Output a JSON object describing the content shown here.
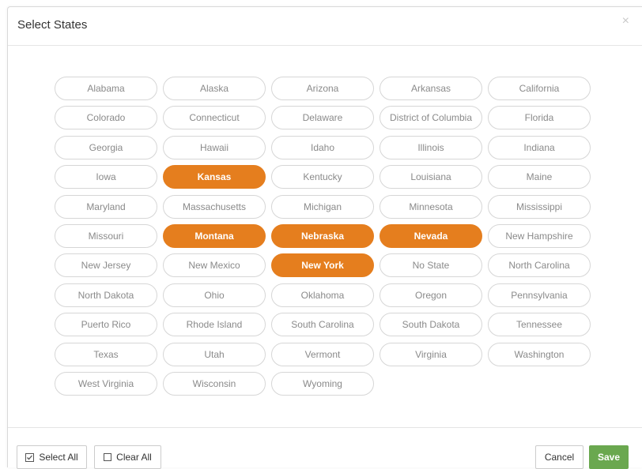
{
  "modal": {
    "title": "Select States",
    "close_glyph": "×"
  },
  "states": [
    {
      "label": "Alabama",
      "selected": false
    },
    {
      "label": "Alaska",
      "selected": false
    },
    {
      "label": "Arizona",
      "selected": false
    },
    {
      "label": "Arkansas",
      "selected": false
    },
    {
      "label": "California",
      "selected": false
    },
    {
      "label": "Colorado",
      "selected": false
    },
    {
      "label": "Connecticut",
      "selected": false
    },
    {
      "label": "Delaware",
      "selected": false
    },
    {
      "label": "District of Columbia",
      "selected": false
    },
    {
      "label": "Florida",
      "selected": false
    },
    {
      "label": "Georgia",
      "selected": false
    },
    {
      "label": "Hawaii",
      "selected": false
    },
    {
      "label": "Idaho",
      "selected": false
    },
    {
      "label": "Illinois",
      "selected": false
    },
    {
      "label": "Indiana",
      "selected": false
    },
    {
      "label": "Iowa",
      "selected": false
    },
    {
      "label": "Kansas",
      "selected": true
    },
    {
      "label": "Kentucky",
      "selected": false
    },
    {
      "label": "Louisiana",
      "selected": false
    },
    {
      "label": "Maine",
      "selected": false
    },
    {
      "label": "Maryland",
      "selected": false
    },
    {
      "label": "Massachusetts",
      "selected": false
    },
    {
      "label": "Michigan",
      "selected": false
    },
    {
      "label": "Minnesota",
      "selected": false
    },
    {
      "label": "Mississippi",
      "selected": false
    },
    {
      "label": "Missouri",
      "selected": false
    },
    {
      "label": "Montana",
      "selected": true
    },
    {
      "label": "Nebraska",
      "selected": true
    },
    {
      "label": "Nevada",
      "selected": true
    },
    {
      "label": "New Hampshire",
      "selected": false
    },
    {
      "label": "New Jersey",
      "selected": false
    },
    {
      "label": "New Mexico",
      "selected": false
    },
    {
      "label": "New York",
      "selected": true
    },
    {
      "label": "No State",
      "selected": false
    },
    {
      "label": "North Carolina",
      "selected": false
    },
    {
      "label": "North Dakota",
      "selected": false
    },
    {
      "label": "Ohio",
      "selected": false
    },
    {
      "label": "Oklahoma",
      "selected": false
    },
    {
      "label": "Oregon",
      "selected": false
    },
    {
      "label": "Pennsylvania",
      "selected": false
    },
    {
      "label": "Puerto Rico",
      "selected": false
    },
    {
      "label": "Rhode Island",
      "selected": false
    },
    {
      "label": "South Carolina",
      "selected": false
    },
    {
      "label": "South Dakota",
      "selected": false
    },
    {
      "label": "Tennessee",
      "selected": false
    },
    {
      "label": "Texas",
      "selected": false
    },
    {
      "label": "Utah",
      "selected": false
    },
    {
      "label": "Vermont",
      "selected": false
    },
    {
      "label": "Virginia",
      "selected": false
    },
    {
      "label": "Washington",
      "selected": false
    },
    {
      "label": "West Virginia",
      "selected": false
    },
    {
      "label": "Wisconsin",
      "selected": false
    },
    {
      "label": "Wyoming",
      "selected": false
    }
  ],
  "footer": {
    "select_all_label": "Select All",
    "select_all_icon": "checked-square-icon",
    "clear_all_label": "Clear All",
    "clear_all_icon": "empty-square-icon",
    "cancel_label": "Cancel",
    "save_label": "Save"
  },
  "colors": {
    "selected_accent": "#e57e1e",
    "save_button": "#6aa84f"
  }
}
